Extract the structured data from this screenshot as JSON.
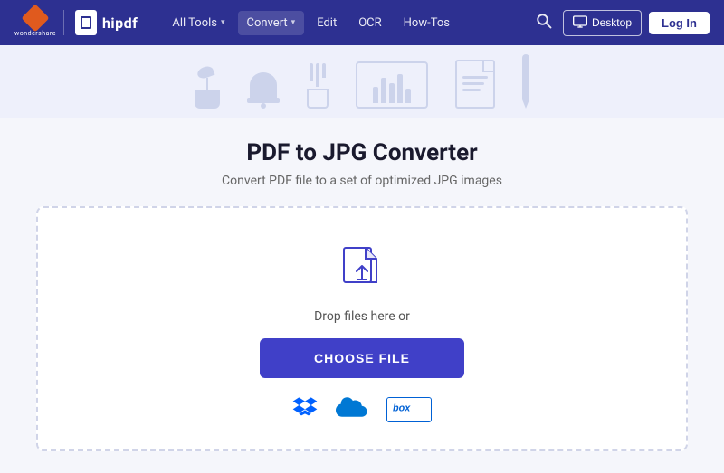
{
  "brand": {
    "wondershare": "wondershare",
    "hipdf": "hipdf"
  },
  "nav": {
    "items": [
      {
        "label": "All Tools",
        "hasDropdown": true
      },
      {
        "label": "Convert",
        "hasDropdown": true
      },
      {
        "label": "Edit",
        "hasDropdown": false
      },
      {
        "label": "OCR",
        "hasDropdown": false
      },
      {
        "label": "How-Tos",
        "hasDropdown": false
      }
    ],
    "desktop_btn": "Desktop",
    "login_btn": "Log In"
  },
  "page": {
    "title": "PDF to JPG Converter",
    "subtitle": "Convert PDF file to a set of optimized JPG images"
  },
  "upload": {
    "drop_text": "Drop files here or",
    "choose_file_btn": "CHOOSE FILE",
    "cloud_services": [
      "Dropbox",
      "OneDrive",
      "Box"
    ]
  }
}
